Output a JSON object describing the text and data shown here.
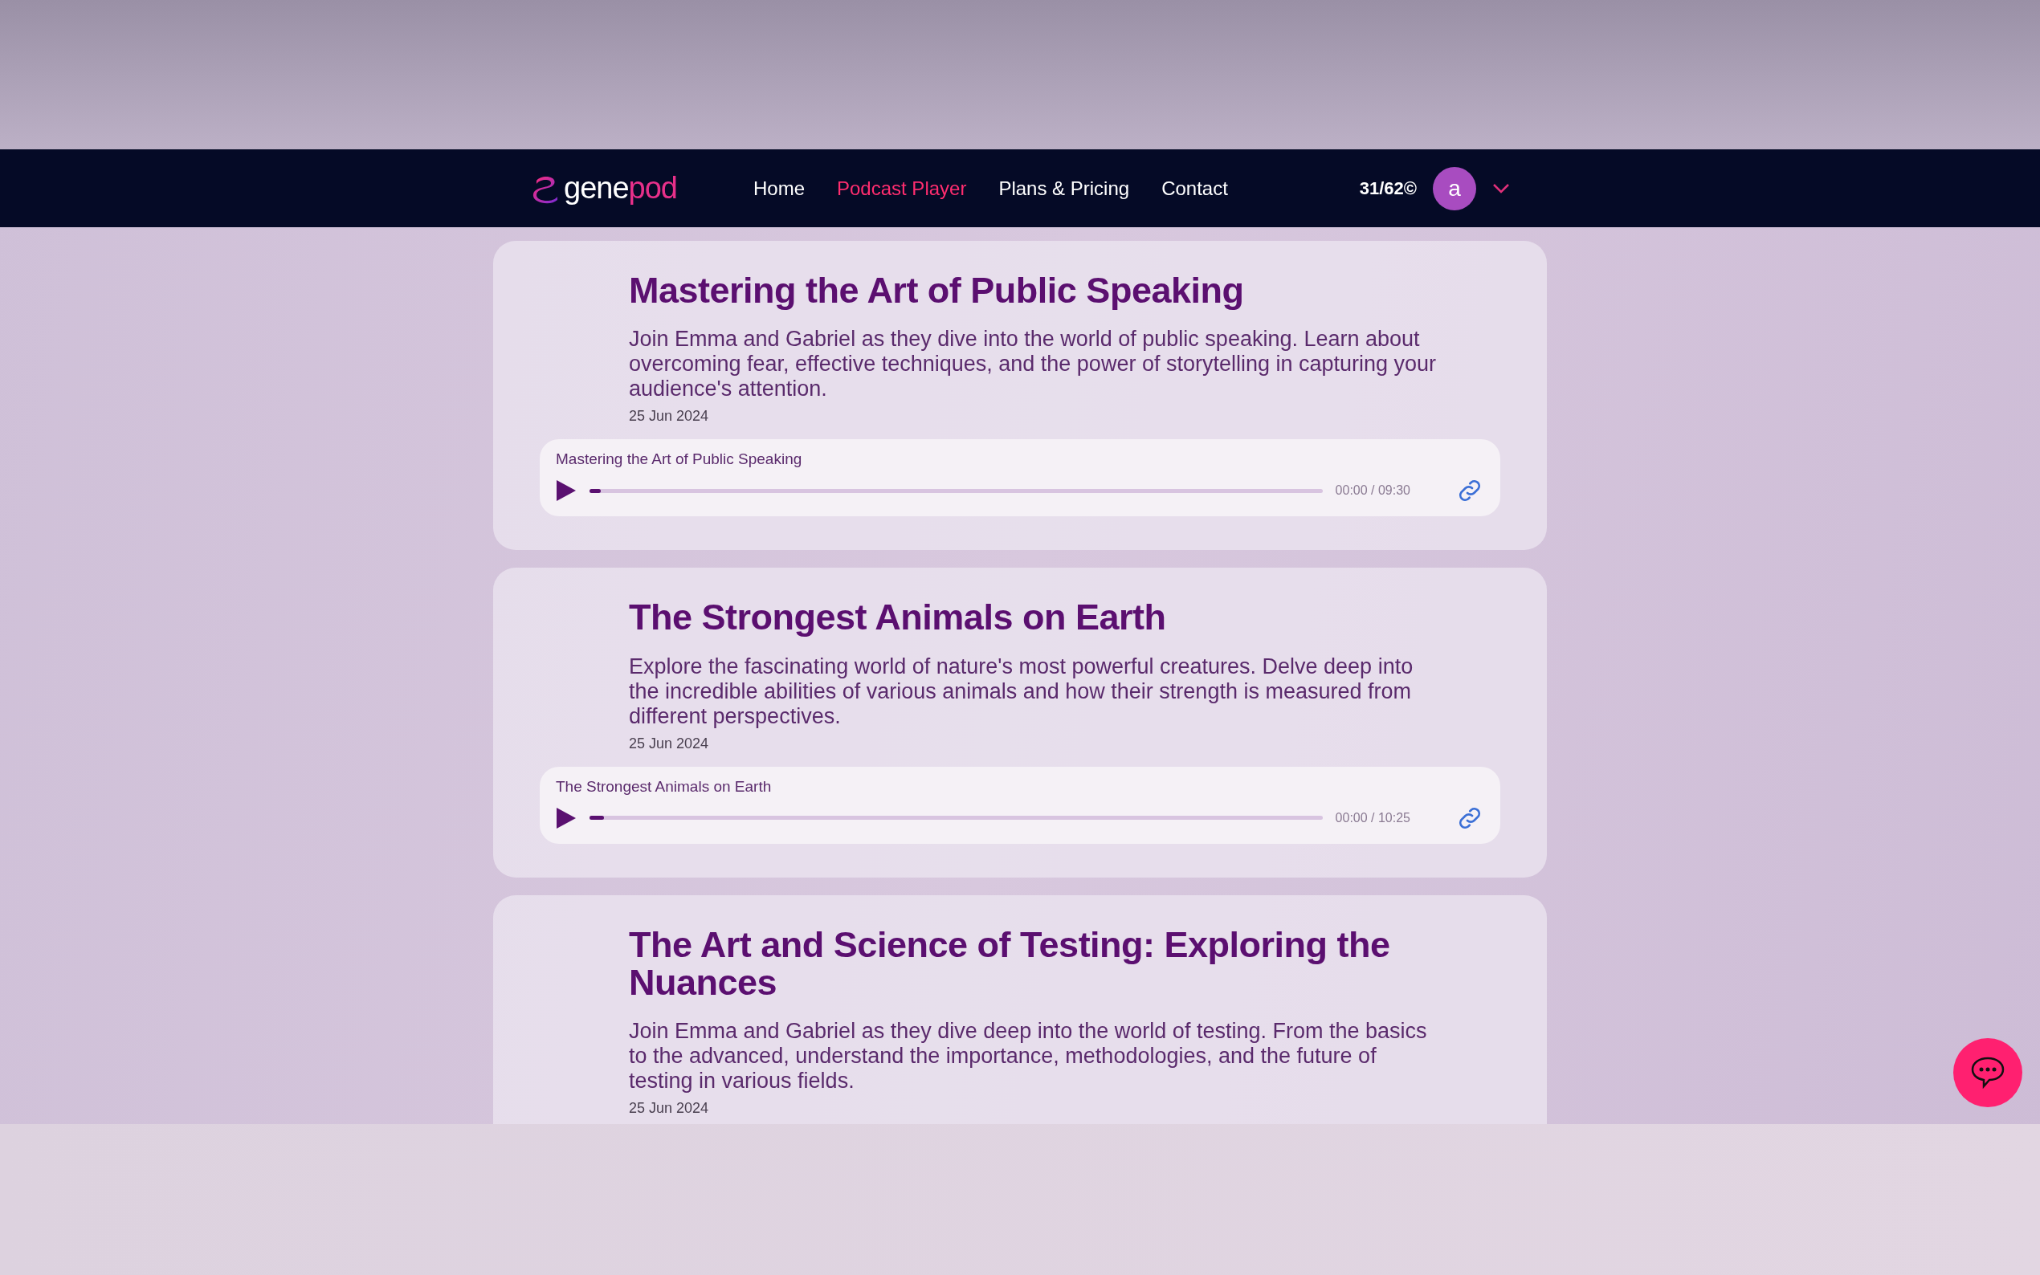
{
  "nav": {
    "logo": {
      "part_1": "gene",
      "part_2": "pod"
    },
    "links": [
      {
        "label": "Home",
        "selected": false
      },
      {
        "label": "Podcast Player",
        "selected": true
      },
      {
        "label": "Plans & Pricing",
        "selected": false
      },
      {
        "label": "Contact",
        "selected": false
      }
    ],
    "credits": "31/62",
    "credits_symbol": "©",
    "avatar_letter": "a"
  },
  "episodes": [
    {
      "title": "Mastering the Art of Public Speaking",
      "description": "Join Emma and Gabriel as they dive into the world of public speaking. Learn about overcoming fear, effective techniques, and the power of storytelling in capturing your audience's attention.",
      "date": "25 Jun 2024",
      "player": {
        "title": "Mastering the Art of Public Speaking",
        "level": 0.015,
        "time": "00:00 / 09:30"
      }
    },
    {
      "title": "The Strongest Animals on Earth",
      "description": "Explore the fascinating world of nature's most powerful creatures. Delve deep into the incredible abilities of various animals and how their strength is measured from different perspectives.",
      "date": "25 Jun 2024",
      "player": {
        "title": "The Strongest Animals on Earth",
        "level": 0.02,
        "time": "00:00 / 10:25"
      }
    },
    {
      "title": "The Art and Science of Testing: Exploring the Nuances",
      "description": "Join Emma and Gabriel as they dive deep into the world of testing. From the basics to the advanced, understand the importance, methodologies, and the future of testing in various fields.",
      "date": "25 Jun 2024"
    }
  ]
}
